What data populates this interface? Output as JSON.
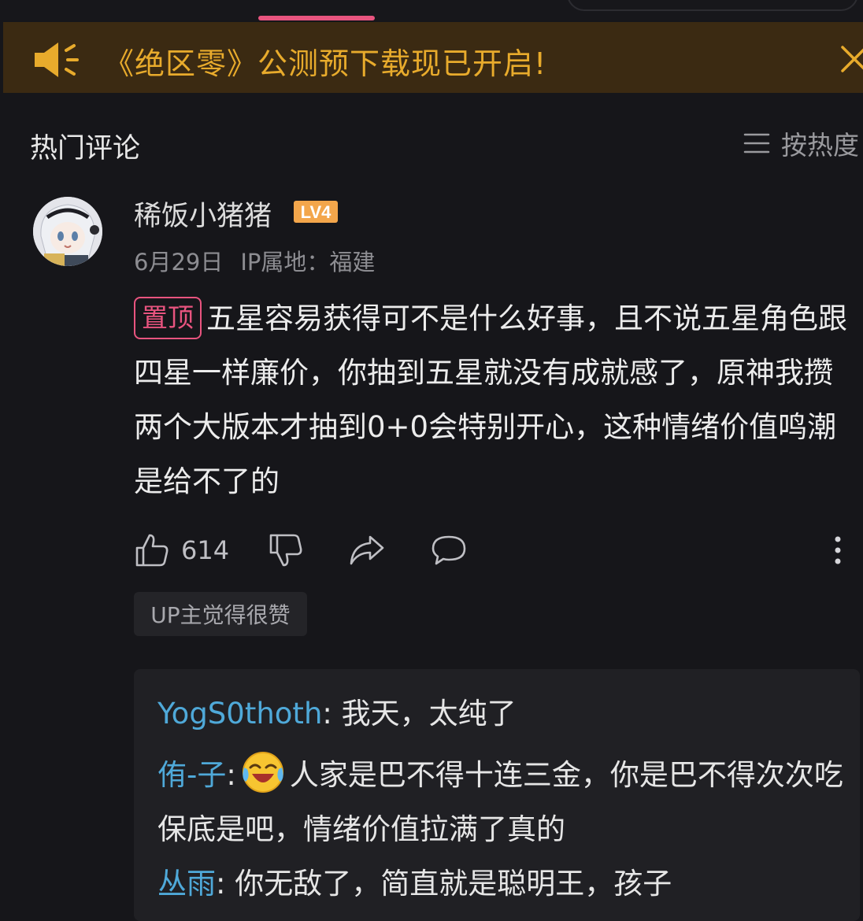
{
  "notice": {
    "text": "《绝区零》公测预下载现已开启!"
  },
  "comments_header": {
    "title": "热门评论",
    "sort_label": "按热度"
  },
  "comment": {
    "username": "稀饭小猪猪",
    "level": "LV4",
    "date": "6月29日",
    "ip_location": "IP属地：福建",
    "pin_label": "置顶",
    "body": "五星容易获得可不是什么好事，且不说五星角色跟四星一样廉价，你抽到五星就没有成就感了，原神我攒两个大版本才抽到0+0会特别开心，这种情绪价值鸣潮是给不了的",
    "like_count": "614",
    "up_like_badge": "UP主觉得很赞"
  },
  "replies": [
    {
      "name": "YogS0thoth",
      "sep": ":",
      "text": " 我天，太纯了"
    },
    {
      "name": "侑-子",
      "sep": ":",
      "emoji": "laughing-crying-emoji",
      "text": "人家是巴不得十连三金，你是巴不得次次吃保底是吧，情绪价值拉满了真的"
    },
    {
      "name": "丛雨",
      "sep": ":",
      "text": " 你无敌了，简直就是聪明王，孩子"
    }
  ],
  "colors": {
    "accent_pink": "#e8547f",
    "notice_bg": "#3b2a12",
    "notice_text": "#e8ab2c",
    "reply_name": "#4fa9d9",
    "background": "#16161a"
  }
}
